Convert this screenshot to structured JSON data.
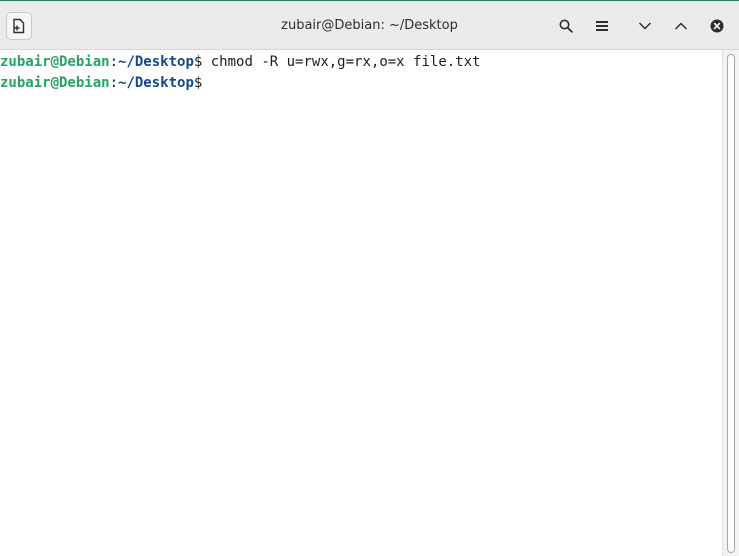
{
  "window": {
    "title": "zubair@Debian: ~/Desktop"
  },
  "toolbar": {
    "new_tab_icon": "new-tab-icon",
    "search_icon": "search-icon",
    "menu_icon": "hamburger-menu-icon",
    "minimize_icon": "chevron-down-icon",
    "maximize_icon": "chevron-up-icon",
    "close_icon": "close-icon"
  },
  "terminal": {
    "lines": [
      {
        "user_host": "zubair@Debian",
        "separator": ":",
        "path": "~/Desktop",
        "prompt": "$",
        "command": " chmod -R u=rwx,g=rx,o=x file.txt"
      },
      {
        "user_host": "zubair@Debian",
        "separator": ":",
        "path": "~/Desktop",
        "prompt": "$",
        "command": ""
      }
    ]
  },
  "colors": {
    "user_host": "#26a269",
    "path": "#12488b",
    "text": "#1e1e1e",
    "titlebar": "#ebebeb"
  }
}
